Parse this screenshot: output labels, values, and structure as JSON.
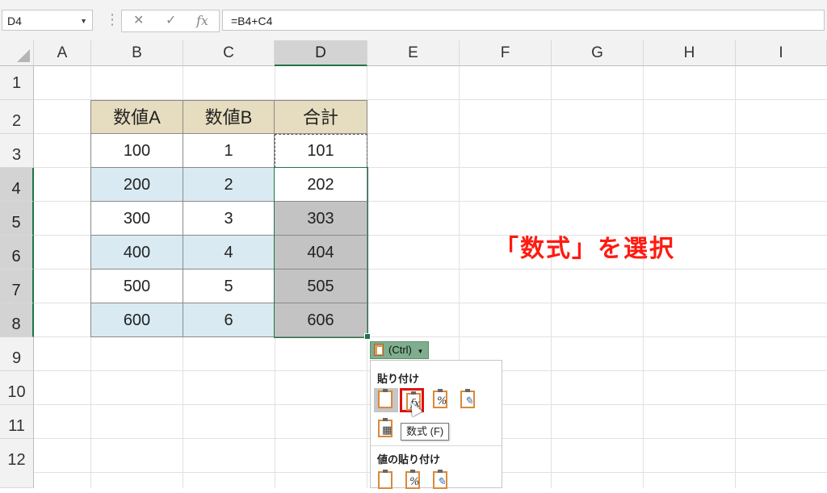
{
  "formula_bar": {
    "name_box": "D4",
    "cancel_icon": "✕",
    "enter_icon": "✓",
    "fx_label": "fx",
    "formula": "=B4+C4"
  },
  "columns": [
    "A",
    "B",
    "C",
    "D",
    "E",
    "F",
    "G",
    "H",
    "I"
  ],
  "rows": [
    "1",
    "2",
    "3",
    "4",
    "5",
    "6",
    "7",
    "8",
    "9",
    "10",
    "11",
    "12"
  ],
  "table": {
    "headers": [
      "数値A",
      "数値B",
      "合計"
    ],
    "rows": [
      [
        "100",
        "1",
        "101"
      ],
      [
        "200",
        "2",
        "202"
      ],
      [
        "300",
        "3",
        "303"
      ],
      [
        "400",
        "4",
        "404"
      ],
      [
        "500",
        "5",
        "505"
      ],
      [
        "600",
        "6",
        "606"
      ]
    ]
  },
  "annotation": "「数式」を選択",
  "paste_options": {
    "button_label": "(Ctrl)",
    "section_paste": "貼り付け",
    "section_paste_values": "値の貼り付け",
    "tooltip": "数式 (F)",
    "icons": [
      "paste-icon",
      "paste-formulas-icon",
      "paste-formulas-number-format-icon",
      "paste-keep-source-formatting-icon",
      "paste-no-borders-icon",
      "paste-values-icon",
      "paste-values-number-format-icon",
      "paste-values-source-format-icon"
    ]
  },
  "colors": {
    "header_fill": "#e6dcbf",
    "blue_fill": "#d9eaf2",
    "selected_fill": "#c3c3c3",
    "annotation": "#ff1a0f",
    "excel_green": "#217346"
  }
}
